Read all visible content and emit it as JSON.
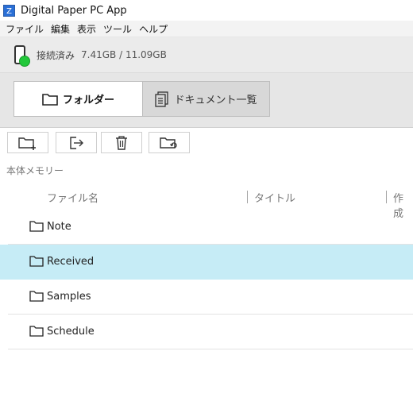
{
  "app": {
    "title": "Digital Paper PC App"
  },
  "menu": [
    "ファイル",
    "編集",
    "表示",
    "ツール",
    "ヘルプ"
  ],
  "status": {
    "state": "接続済み",
    "storage": "7.41GB / 11.09GB",
    "connected_color": "#22c83a"
  },
  "tabs": [
    {
      "label": "フォルダー",
      "icon": "folder-icon",
      "active": true
    },
    {
      "label": "ドキュメント一覧",
      "icon": "document-list-icon",
      "active": false
    }
  ],
  "toolbar": {
    "buttons": [
      {
        "icon": "new-folder-icon"
      },
      {
        "icon": "move-icon"
      },
      {
        "icon": "trash-icon"
      },
      {
        "icon": "sync-folder-icon"
      }
    ]
  },
  "section": {
    "label": "本体メモリー"
  },
  "columns": [
    "ファイル名",
    "タイトル",
    "作成"
  ],
  "folders": [
    {
      "name": "Note",
      "selected": false
    },
    {
      "name": "Received",
      "selected": true
    },
    {
      "name": "Samples",
      "selected": false
    },
    {
      "name": "Schedule",
      "selected": false
    }
  ],
  "colors": {
    "selection": "#c6ecf6"
  }
}
